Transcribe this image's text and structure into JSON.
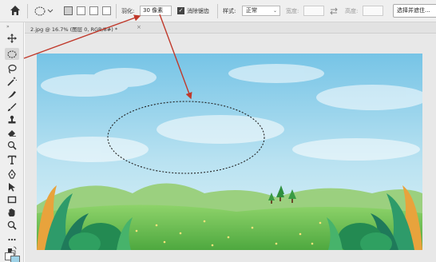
{
  "options_bar": {
    "home_icon": "home-icon",
    "feather_label": "羽化:",
    "feather_value": "30 像素",
    "antialias_label": "消除锯齿",
    "antialias_checked": true,
    "style_label": "样式:",
    "style_value": "正常",
    "width_label": "宽度:",
    "height_label": "高度:",
    "select_subject_label": "选择并遮住..."
  },
  "document": {
    "tab_title": "2.jpg @ 16.7% (图层 0, RGB/8#) *",
    "close_icon": "close-icon"
  },
  "toolbar": {
    "active_tool": "elliptical-marquee",
    "tools": [
      "move",
      "elliptical-marquee",
      "lasso",
      "magic-wand",
      "crop",
      "eyedropper",
      "healing-brush",
      "brush",
      "clone-stamp",
      "eraser",
      "burn",
      "type",
      "pen",
      "path-select",
      "rectangle",
      "hand",
      "zoom",
      "more"
    ],
    "foreground_color": "#ffffff",
    "background_color": "#9fd3e8"
  },
  "annotations": {
    "arrow_color": "#c0392b"
  }
}
